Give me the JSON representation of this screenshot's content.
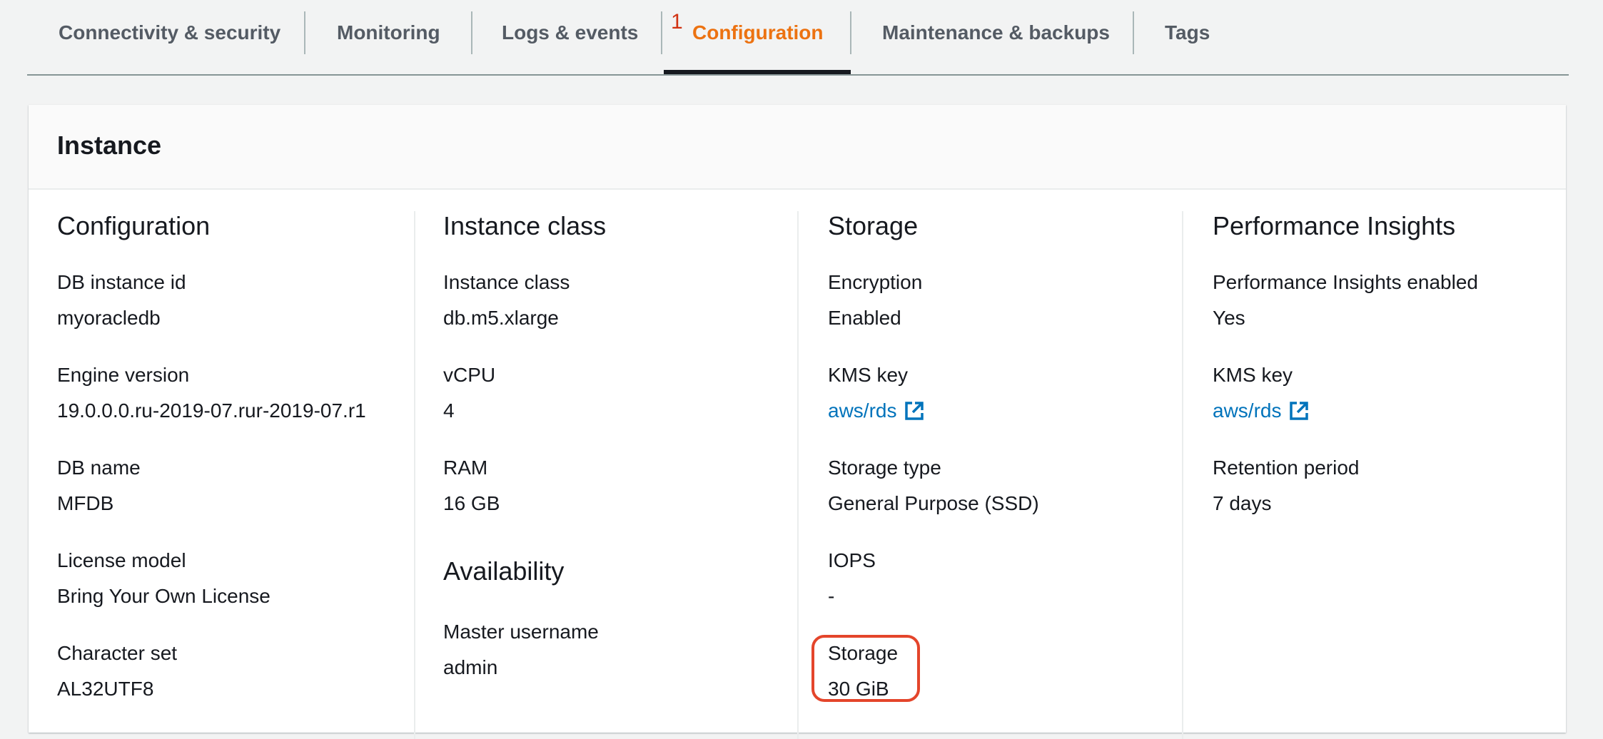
{
  "tabs": [
    {
      "label": "Connectivity & security",
      "active": false
    },
    {
      "label": "Monitoring",
      "active": false
    },
    {
      "label": "Logs & events",
      "active": false
    },
    {
      "label": "Configuration",
      "active": true
    },
    {
      "label": "Maintenance & backups",
      "active": false
    },
    {
      "label": "Tags",
      "active": false
    }
  ],
  "annotation_number": "1",
  "panel": {
    "title": "Instance",
    "configuration": {
      "title": "Configuration",
      "fields": [
        {
          "label": "DB instance id",
          "value": "myoracledb"
        },
        {
          "label": "Engine version",
          "value": "19.0.0.0.ru-2019-07.rur-2019-07.r1"
        },
        {
          "label": "DB name",
          "value": "MFDB"
        },
        {
          "label": "License model",
          "value": "Bring Your Own License"
        },
        {
          "label": "Character set",
          "value": "AL32UTF8"
        }
      ]
    },
    "instance_class": {
      "title": "Instance class",
      "fields": [
        {
          "label": "Instance class",
          "value": "db.m5.xlarge"
        },
        {
          "label": "vCPU",
          "value": "4"
        },
        {
          "label": "RAM",
          "value": "16 GB"
        }
      ],
      "availability": {
        "title": "Availability",
        "fields": [
          {
            "label": "Master username",
            "value": "admin"
          }
        ]
      }
    },
    "storage": {
      "title": "Storage",
      "fields": [
        {
          "label": "Encryption",
          "value": "Enabled"
        },
        {
          "label": "KMS key",
          "value": "aws/rds"
        },
        {
          "label": "Storage type",
          "value": "General Purpose (SSD)"
        },
        {
          "label": "IOPS",
          "value": "-"
        },
        {
          "label": "Storage",
          "value": "30 GiB"
        }
      ]
    },
    "performance_insights": {
      "title": "Performance Insights",
      "fields": [
        {
          "label": "Performance Insights enabled",
          "value": "Yes"
        },
        {
          "label": "KMS key",
          "value": "aws/rds"
        },
        {
          "label": "Retention period",
          "value": "7 days"
        }
      ]
    }
  },
  "colors": {
    "active_tab": "#ec7211",
    "link": "#0073bb",
    "annotation": "#e4452b"
  },
  "icons": {
    "external_link": "external-link-icon"
  }
}
